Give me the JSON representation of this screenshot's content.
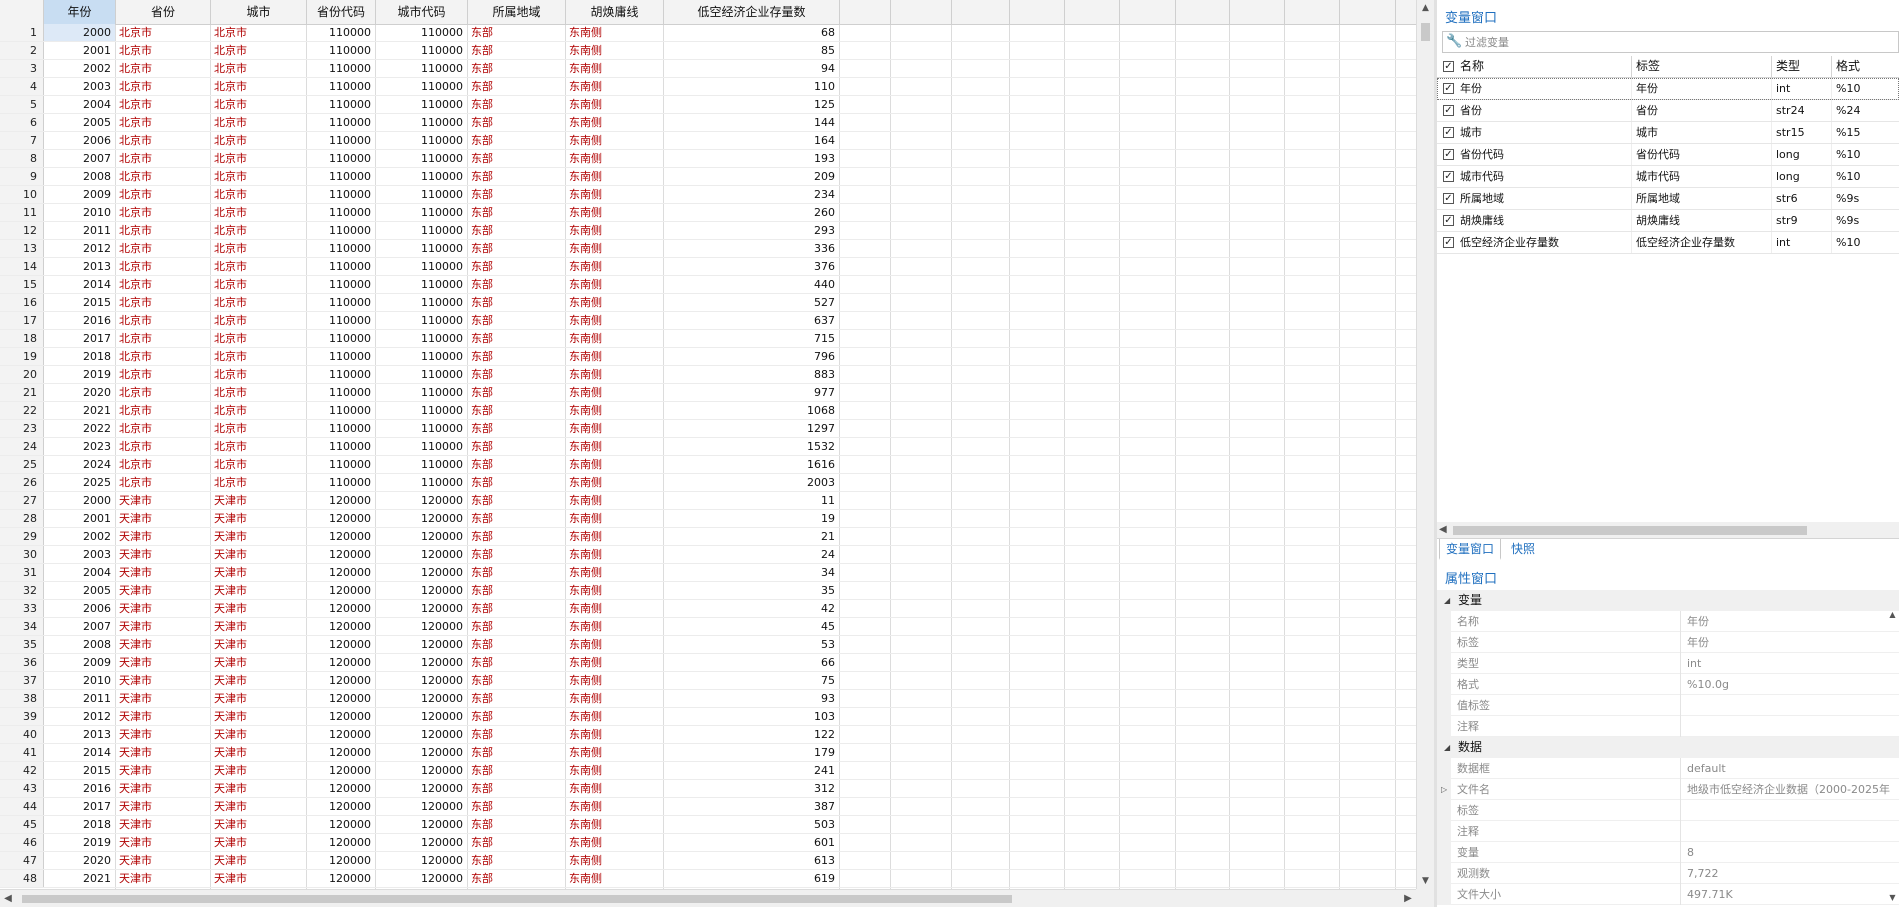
{
  "grid": {
    "columns": [
      "年份",
      "省份",
      "城市",
      "省份代码",
      "城市代码",
      "所属地域",
      "胡焕庸线",
      "低空经济企业存量数"
    ],
    "selected_column": 0,
    "rows": [
      [
        "1",
        "2000",
        "北京市",
        "北京市",
        "110000",
        "110000",
        "东部",
        "东南侧",
        "68"
      ],
      [
        "2",
        "2001",
        "北京市",
        "北京市",
        "110000",
        "110000",
        "东部",
        "东南侧",
        "85"
      ],
      [
        "3",
        "2002",
        "北京市",
        "北京市",
        "110000",
        "110000",
        "东部",
        "东南侧",
        "94"
      ],
      [
        "4",
        "2003",
        "北京市",
        "北京市",
        "110000",
        "110000",
        "东部",
        "东南侧",
        "110"
      ],
      [
        "5",
        "2004",
        "北京市",
        "北京市",
        "110000",
        "110000",
        "东部",
        "东南侧",
        "125"
      ],
      [
        "6",
        "2005",
        "北京市",
        "北京市",
        "110000",
        "110000",
        "东部",
        "东南侧",
        "144"
      ],
      [
        "7",
        "2006",
        "北京市",
        "北京市",
        "110000",
        "110000",
        "东部",
        "东南侧",
        "164"
      ],
      [
        "8",
        "2007",
        "北京市",
        "北京市",
        "110000",
        "110000",
        "东部",
        "东南侧",
        "193"
      ],
      [
        "9",
        "2008",
        "北京市",
        "北京市",
        "110000",
        "110000",
        "东部",
        "东南侧",
        "209"
      ],
      [
        "10",
        "2009",
        "北京市",
        "北京市",
        "110000",
        "110000",
        "东部",
        "东南侧",
        "234"
      ],
      [
        "11",
        "2010",
        "北京市",
        "北京市",
        "110000",
        "110000",
        "东部",
        "东南侧",
        "260"
      ],
      [
        "12",
        "2011",
        "北京市",
        "北京市",
        "110000",
        "110000",
        "东部",
        "东南侧",
        "293"
      ],
      [
        "13",
        "2012",
        "北京市",
        "北京市",
        "110000",
        "110000",
        "东部",
        "东南侧",
        "336"
      ],
      [
        "14",
        "2013",
        "北京市",
        "北京市",
        "110000",
        "110000",
        "东部",
        "东南侧",
        "376"
      ],
      [
        "15",
        "2014",
        "北京市",
        "北京市",
        "110000",
        "110000",
        "东部",
        "东南侧",
        "440"
      ],
      [
        "16",
        "2015",
        "北京市",
        "北京市",
        "110000",
        "110000",
        "东部",
        "东南侧",
        "527"
      ],
      [
        "17",
        "2016",
        "北京市",
        "北京市",
        "110000",
        "110000",
        "东部",
        "东南侧",
        "637"
      ],
      [
        "18",
        "2017",
        "北京市",
        "北京市",
        "110000",
        "110000",
        "东部",
        "东南侧",
        "715"
      ],
      [
        "19",
        "2018",
        "北京市",
        "北京市",
        "110000",
        "110000",
        "东部",
        "东南侧",
        "796"
      ],
      [
        "20",
        "2019",
        "北京市",
        "北京市",
        "110000",
        "110000",
        "东部",
        "东南侧",
        "883"
      ],
      [
        "21",
        "2020",
        "北京市",
        "北京市",
        "110000",
        "110000",
        "东部",
        "东南侧",
        "977"
      ],
      [
        "22",
        "2021",
        "北京市",
        "北京市",
        "110000",
        "110000",
        "东部",
        "东南侧",
        "1068"
      ],
      [
        "23",
        "2022",
        "北京市",
        "北京市",
        "110000",
        "110000",
        "东部",
        "东南侧",
        "1297"
      ],
      [
        "24",
        "2023",
        "北京市",
        "北京市",
        "110000",
        "110000",
        "东部",
        "东南侧",
        "1532"
      ],
      [
        "25",
        "2024",
        "北京市",
        "北京市",
        "110000",
        "110000",
        "东部",
        "东南侧",
        "1616"
      ],
      [
        "26",
        "2025",
        "北京市",
        "北京市",
        "110000",
        "110000",
        "东部",
        "东南侧",
        "2003"
      ],
      [
        "27",
        "2000",
        "天津市",
        "天津市",
        "120000",
        "120000",
        "东部",
        "东南侧",
        "11"
      ],
      [
        "28",
        "2001",
        "天津市",
        "天津市",
        "120000",
        "120000",
        "东部",
        "东南侧",
        "19"
      ],
      [
        "29",
        "2002",
        "天津市",
        "天津市",
        "120000",
        "120000",
        "东部",
        "东南侧",
        "21"
      ],
      [
        "30",
        "2003",
        "天津市",
        "天津市",
        "120000",
        "120000",
        "东部",
        "东南侧",
        "24"
      ],
      [
        "31",
        "2004",
        "天津市",
        "天津市",
        "120000",
        "120000",
        "东部",
        "东南侧",
        "34"
      ],
      [
        "32",
        "2005",
        "天津市",
        "天津市",
        "120000",
        "120000",
        "东部",
        "东南侧",
        "35"
      ],
      [
        "33",
        "2006",
        "天津市",
        "天津市",
        "120000",
        "120000",
        "东部",
        "东南侧",
        "42"
      ],
      [
        "34",
        "2007",
        "天津市",
        "天津市",
        "120000",
        "120000",
        "东部",
        "东南侧",
        "45"
      ],
      [
        "35",
        "2008",
        "天津市",
        "天津市",
        "120000",
        "120000",
        "东部",
        "东南侧",
        "53"
      ],
      [
        "36",
        "2009",
        "天津市",
        "天津市",
        "120000",
        "120000",
        "东部",
        "东南侧",
        "66"
      ],
      [
        "37",
        "2010",
        "天津市",
        "天津市",
        "120000",
        "120000",
        "东部",
        "东南侧",
        "75"
      ],
      [
        "38",
        "2011",
        "天津市",
        "天津市",
        "120000",
        "120000",
        "东部",
        "东南侧",
        "93"
      ],
      [
        "39",
        "2012",
        "天津市",
        "天津市",
        "120000",
        "120000",
        "东部",
        "东南侧",
        "103"
      ],
      [
        "40",
        "2013",
        "天津市",
        "天津市",
        "120000",
        "120000",
        "东部",
        "东南侧",
        "122"
      ],
      [
        "41",
        "2014",
        "天津市",
        "天津市",
        "120000",
        "120000",
        "东部",
        "东南侧",
        "179"
      ],
      [
        "42",
        "2015",
        "天津市",
        "天津市",
        "120000",
        "120000",
        "东部",
        "东南侧",
        "241"
      ],
      [
        "43",
        "2016",
        "天津市",
        "天津市",
        "120000",
        "120000",
        "东部",
        "东南侧",
        "312"
      ],
      [
        "44",
        "2017",
        "天津市",
        "天津市",
        "120000",
        "120000",
        "东部",
        "东南侧",
        "387"
      ],
      [
        "45",
        "2018",
        "天津市",
        "天津市",
        "120000",
        "120000",
        "东部",
        "东南侧",
        "503"
      ],
      [
        "46",
        "2019",
        "天津市",
        "天津市",
        "120000",
        "120000",
        "东部",
        "东南侧",
        "601"
      ],
      [
        "47",
        "2020",
        "天津市",
        "天津市",
        "120000",
        "120000",
        "东部",
        "东南侧",
        "613"
      ],
      [
        "48",
        "2021",
        "天津市",
        "天津市",
        "120000",
        "120000",
        "东部",
        "东南侧",
        "619"
      ]
    ]
  },
  "variables_window": {
    "title": "变量窗口",
    "filter_placeholder": "过滤变量",
    "filter_icon": "wrench-icon",
    "headers": [
      "名称",
      "标签",
      "类型",
      "格式"
    ],
    "rows": [
      {
        "name": "年份",
        "label": "年份",
        "type": "int",
        "format": "%10"
      },
      {
        "name": "省份",
        "label": "省份",
        "type": "str24",
        "format": "%24"
      },
      {
        "name": "城市",
        "label": "城市",
        "type": "str15",
        "format": "%15"
      },
      {
        "name": "省份代码",
        "label": "省份代码",
        "type": "long",
        "format": "%10"
      },
      {
        "name": "城市代码",
        "label": "城市代码",
        "type": "long",
        "format": "%10"
      },
      {
        "name": "所属地域",
        "label": "所属地域",
        "type": "str6",
        "format": "%9s"
      },
      {
        "name": "胡焕庸线",
        "label": "胡焕庸线",
        "type": "str9",
        "format": "%9s"
      },
      {
        "name": "低空经济企业存量数",
        "label": "低空经济企业存量数",
        "type": "int",
        "format": "%10"
      }
    ],
    "tabs": [
      "变量窗口",
      "快照"
    ]
  },
  "properties_window": {
    "title": "属性窗口",
    "sections": [
      {
        "name": "变量",
        "rows": [
          {
            "k": "名称",
            "v": "年份"
          },
          {
            "k": "标签",
            "v": "年份"
          },
          {
            "k": "类型",
            "v": "int"
          },
          {
            "k": "格式",
            "v": "%10.0g"
          },
          {
            "k": "值标签",
            "v": ""
          },
          {
            "k": "注释",
            "v": ""
          }
        ]
      },
      {
        "name": "数据",
        "rows": [
          {
            "k": "数据框",
            "v": "default"
          },
          {
            "k": "文件名",
            "v": "地级市低空经济企业数据（2000-2025年",
            "expandable": true
          },
          {
            "k": "标签",
            "v": ""
          },
          {
            "k": "注释",
            "v": ""
          },
          {
            "k": "变量",
            "v": "8"
          },
          {
            "k": "观测数",
            "v": "7,722"
          },
          {
            "k": "文件大小",
            "v": "497.71K"
          }
        ]
      }
    ]
  },
  "colors": {
    "string_cell": "#b00000",
    "accent": "#1f6fbf",
    "header_bg": "#f3f3f3",
    "selected_header": "#c8ddf2"
  }
}
